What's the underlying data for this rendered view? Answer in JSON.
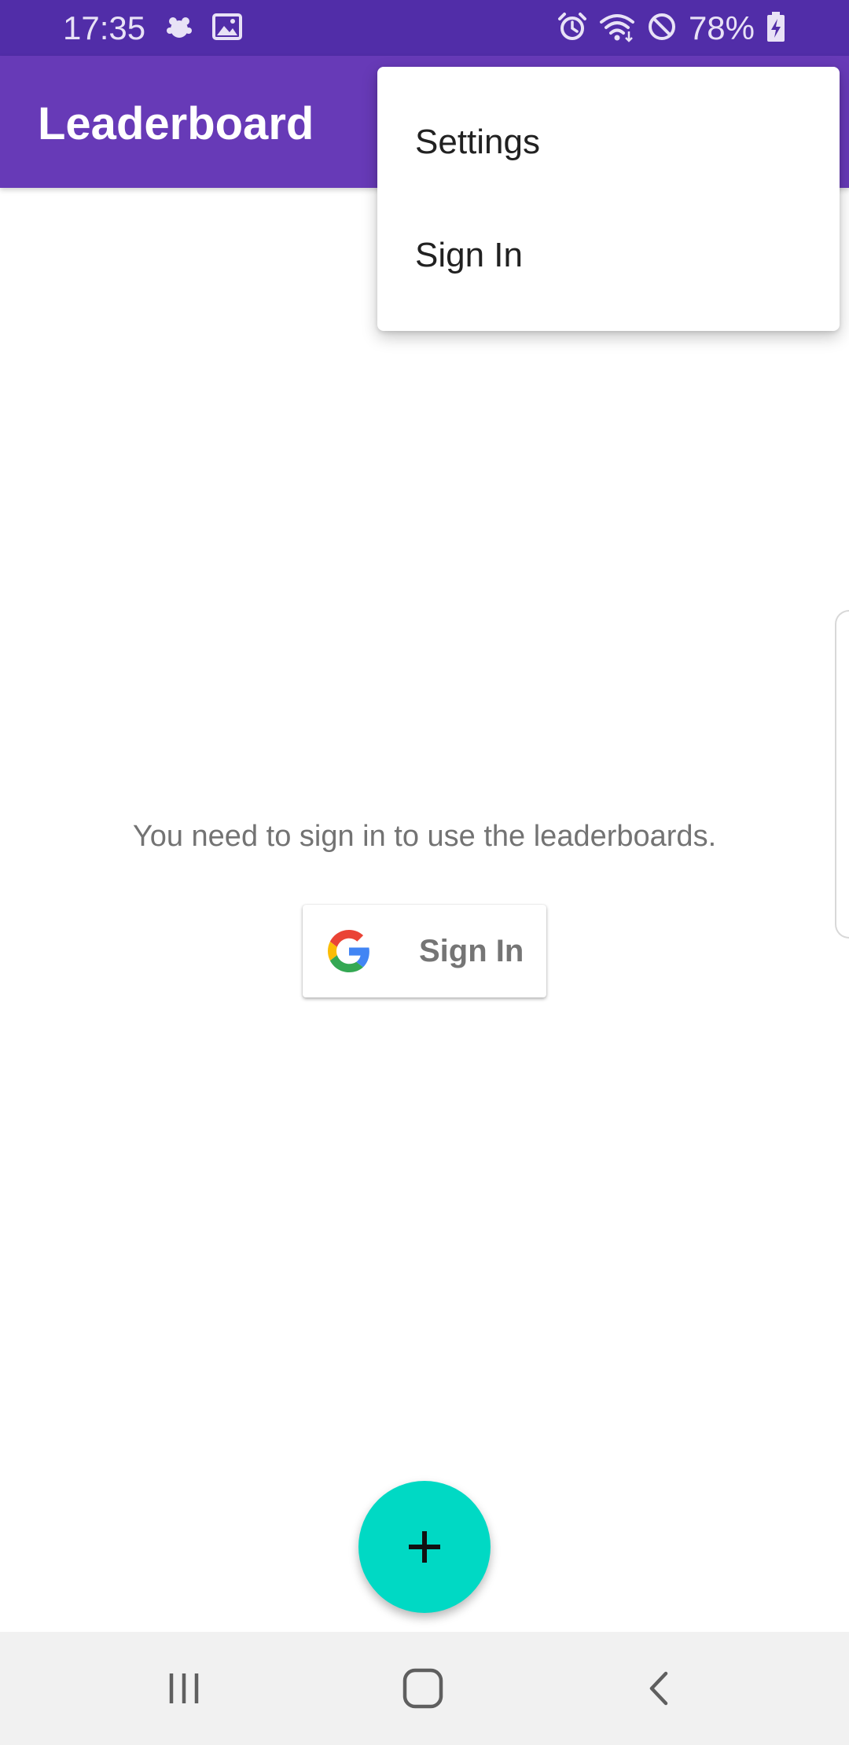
{
  "status_bar": {
    "time": "17:35",
    "battery": "78%",
    "left_icons": [
      "weather-icon",
      "image-icon"
    ],
    "right_icons": [
      "alarm-icon",
      "wifi-icon",
      "do-not-disturb-icon",
      "battery-charging-icon"
    ]
  },
  "app_bar": {
    "title": "Leaderboard"
  },
  "menu": {
    "items": [
      {
        "label": "Settings"
      },
      {
        "label": "Sign In"
      }
    ]
  },
  "main": {
    "message": "You need to sign in to use the leaderboards.",
    "sign_in_button": {
      "label": "Sign In",
      "icon": "google-logo-icon"
    }
  },
  "fab": {
    "icon": "plus-icon"
  },
  "nav_bar": {
    "buttons": [
      "recent-apps-icon",
      "home-icon",
      "back-icon"
    ]
  },
  "colors": {
    "status_bar": "#512da8",
    "app_bar": "#673ab7",
    "fab": "#00d9c4",
    "nav_bar": "#f1f1f1"
  }
}
